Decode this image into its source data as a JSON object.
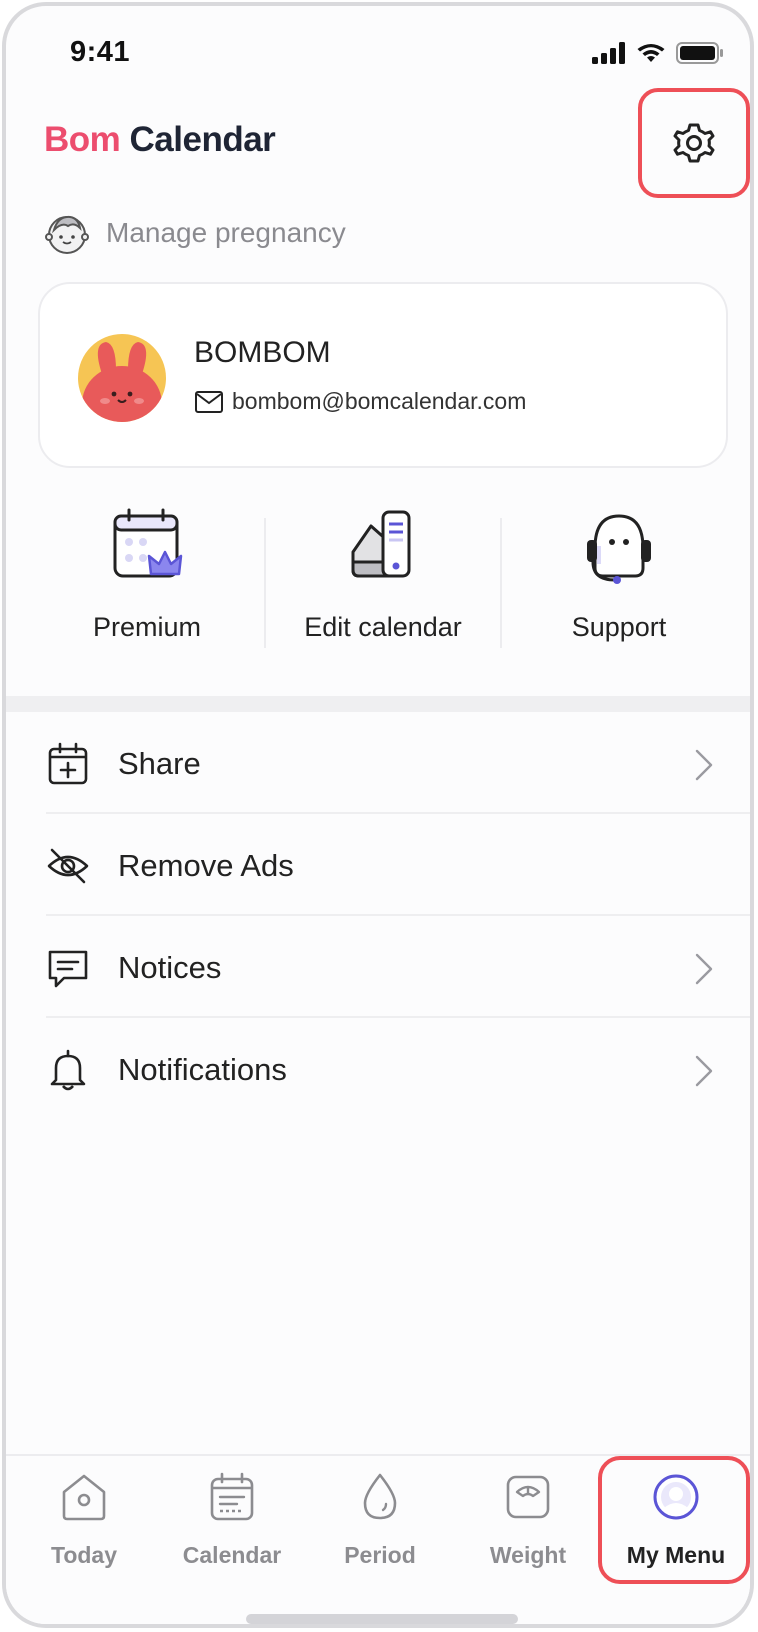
{
  "status": {
    "time": "9:41"
  },
  "brand": {
    "part1": "Bom",
    "part2": "Calendar"
  },
  "pregnancy": {
    "label": "Manage pregnancy"
  },
  "profile": {
    "name": "BOMBOM",
    "email": "bombom@bomcalendar.com"
  },
  "quick_actions": [
    {
      "label": "Premium",
      "icon": "premium-calendar-icon"
    },
    {
      "label": "Edit calendar",
      "icon": "edit-calendar-icon"
    },
    {
      "label": "Support",
      "icon": "support-headset-icon"
    }
  ],
  "menu": [
    {
      "label": "Share",
      "icon": "calendar-add-icon",
      "chevron": true
    },
    {
      "label": "Remove Ads",
      "icon": "eye-off-icon",
      "chevron": false
    },
    {
      "label": "Notices",
      "icon": "message-icon",
      "chevron": true
    },
    {
      "label": "Notifications",
      "icon": "bell-icon",
      "chevron": true
    }
  ],
  "tabs": [
    {
      "label": "Today",
      "icon": "home-icon"
    },
    {
      "label": "Calendar",
      "icon": "calendar-icon"
    },
    {
      "label": "Period",
      "icon": "drop-icon"
    },
    {
      "label": "Weight",
      "icon": "scale-icon"
    },
    {
      "label": "My Menu",
      "icon": "profile-icon",
      "active": true
    }
  ],
  "colors": {
    "brand_pink": "#ec4d6e",
    "brand_dark": "#1f2535",
    "accent_purple": "#5b55d6",
    "highlight_red": "#ee4f57"
  }
}
